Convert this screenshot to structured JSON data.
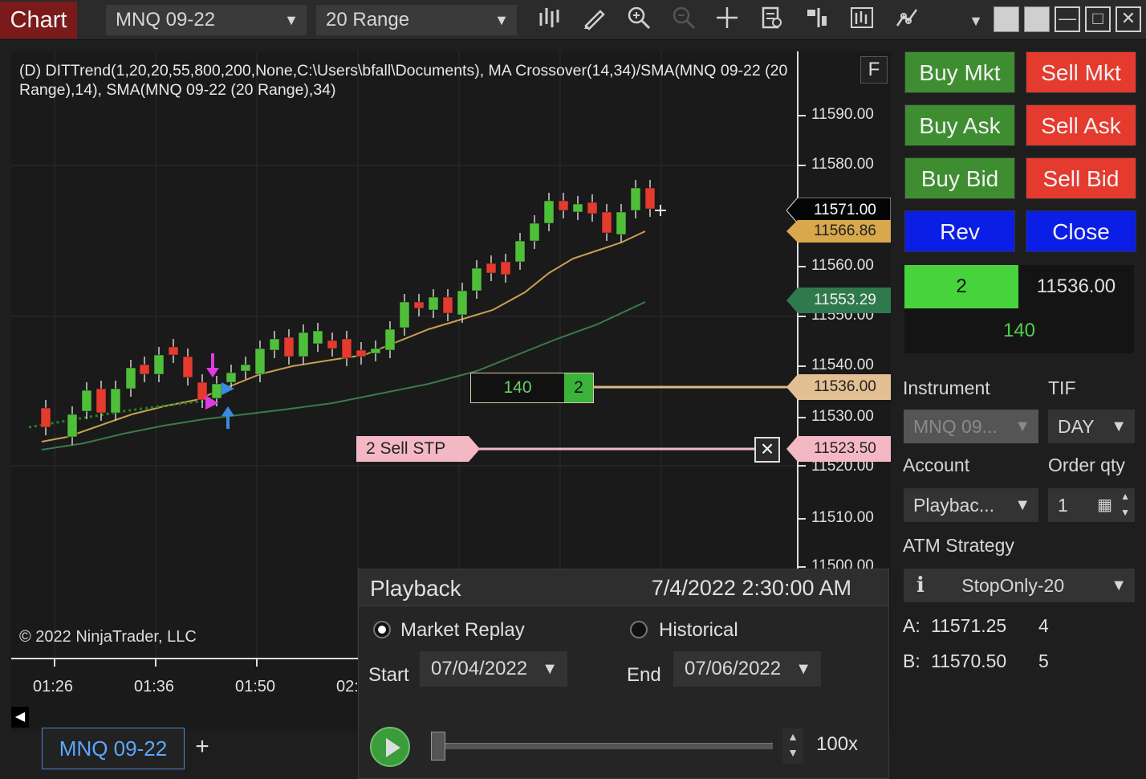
{
  "toolbar": {
    "chart_tab": "Chart",
    "instrument": "MNQ 09-22",
    "bar_type": "20 Range",
    "icons": [
      "bar-type-icon",
      "drawing-tool-icon",
      "zoom-in-icon",
      "zoom-out-icon",
      "crosshair-icon",
      "data-box-icon",
      "indicators-icon",
      "strategies-icon",
      "chart-trader-icon"
    ]
  },
  "chart": {
    "indicator_line": "(D) DITTrend(1,20,20,55,800,200,None,C:\\Users\\bfall\\Documents), MA Crossover(14,34)/SMA(MNQ 09-22 (20 Range),14), SMA(MNQ 09-22 (20 Range),34)",
    "f_button": "F",
    "copyright": "© 2022 NinjaTrader, LLC",
    "price_axis": [
      "11590.00",
      "11580.00",
      "11560.00",
      "11550.00",
      "11540.00",
      "11530.00",
      "11520.00",
      "11510.00",
      "11500.00"
    ],
    "time_axis": [
      "01:26",
      "01:36",
      "01:50",
      "02:"
    ],
    "markers": {
      "last_price": "11571.00",
      "sma14": "11566.86",
      "sma34": "11553.29",
      "entry": "11536.00",
      "stop": "11523.50"
    },
    "entry_order": {
      "pnl": "140",
      "qty": "2"
    },
    "stop_order": {
      "label": "2  Sell STP"
    },
    "colors": {
      "up_candle": "#4fbf3a",
      "down_candle": "#e53a2e",
      "sma14": "#c8a050",
      "sma34": "#3c7a4c"
    }
  },
  "bottom": {
    "tab": "MNQ 09-22",
    "add": "+"
  },
  "playback": {
    "title": "Playback",
    "datetime": "7/4/2022 2:30:00 AM",
    "market_replay": "Market Replay",
    "historical": "Historical",
    "selected_mode": "Market Replay",
    "start_label": "Start",
    "start_date": "07/04/2022",
    "end_label": "End",
    "end_date": "07/06/2022",
    "speed": "100x"
  },
  "chart_trader": {
    "buy_mkt": "Buy Mkt",
    "sell_mkt": "Sell Mkt",
    "buy_ask": "Buy Ask",
    "sell_ask": "Sell Ask",
    "buy_bid": "Buy Bid",
    "sell_bid": "Sell Bid",
    "rev": "Rev",
    "close": "Close",
    "position_qty": "2",
    "position_price": "11536.00",
    "pnl": "140",
    "instrument_label": "Instrument",
    "tif_label": "TIF",
    "instrument_value": "MNQ 09...",
    "tif_value": "DAY",
    "account_label": "Account",
    "order_qty_label": "Order qty",
    "account_value": "Playbac...",
    "order_qty_value": "1",
    "atm_label": "ATM Strategy",
    "atm_value": "StopOnly-20",
    "ask_label": "A:",
    "ask_price": "11571.25",
    "ask_size": "4",
    "bid_label": "B:",
    "bid_price": "11570.50",
    "bid_size": "5"
  }
}
